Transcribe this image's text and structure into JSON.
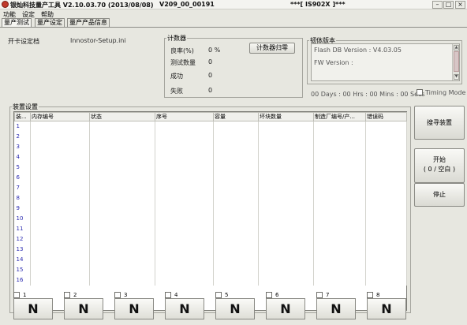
{
  "window": {
    "title_left": "银灿科技量产工具  V2.10.03.70 (2013/08/08)",
    "title_mid": "V209_00_00191",
    "title_right": "***[ IS902X ]***",
    "minimize": "–",
    "maximize": "□",
    "close": "×"
  },
  "menu": [
    "功能",
    "设定",
    "帮助"
  ],
  "tabs": [
    "量产测试",
    "量产设定",
    "量产产品信息"
  ],
  "settings_file": {
    "label": "开卡设定档",
    "value": "Innostor-Setup.ini"
  },
  "counter": {
    "title": "计数器",
    "rows": [
      {
        "label": "良率(%)",
        "value": "0 %"
      },
      {
        "label": "测试数量",
        "value": "0"
      },
      {
        "label": "成功",
        "value": "0"
      },
      {
        "label": "失败",
        "value": "0"
      }
    ],
    "reset_button": "计数器归零"
  },
  "firmware": {
    "title": "韧体版本",
    "flash_db": "Flash DB Version :  V4.03.05",
    "fw": "FW Version :"
  },
  "timer": "00 Days : 00 Hrs : 00 Mins : 00 Secs",
  "timing_mode": "Timing Mode",
  "device_group": {
    "title": "装置设置",
    "columns": [
      "装...",
      "内存编号",
      "状态",
      "序号",
      "容量",
      "坏块数量",
      "制造厂编号/产...",
      "错误码"
    ],
    "rows": [
      "1",
      "2",
      "3",
      "4",
      "5",
      "6",
      "7",
      "8",
      "9",
      "10",
      "11",
      "12",
      "13",
      "14",
      "15",
      "16"
    ]
  },
  "side_buttons": {
    "scan": "搜寻装置",
    "start": "开始",
    "start_sub": "( 0 / 空白 )",
    "stop": "停止"
  },
  "slots": [
    {
      "num": "1",
      "state": "N"
    },
    {
      "num": "2",
      "state": "N"
    },
    {
      "num": "3",
      "state": "N"
    },
    {
      "num": "4",
      "state": "N"
    },
    {
      "num": "5",
      "state": "N"
    },
    {
      "num": "6",
      "state": "N"
    },
    {
      "num": "7",
      "state": "N"
    },
    {
      "num": "8",
      "state": "N"
    }
  ]
}
